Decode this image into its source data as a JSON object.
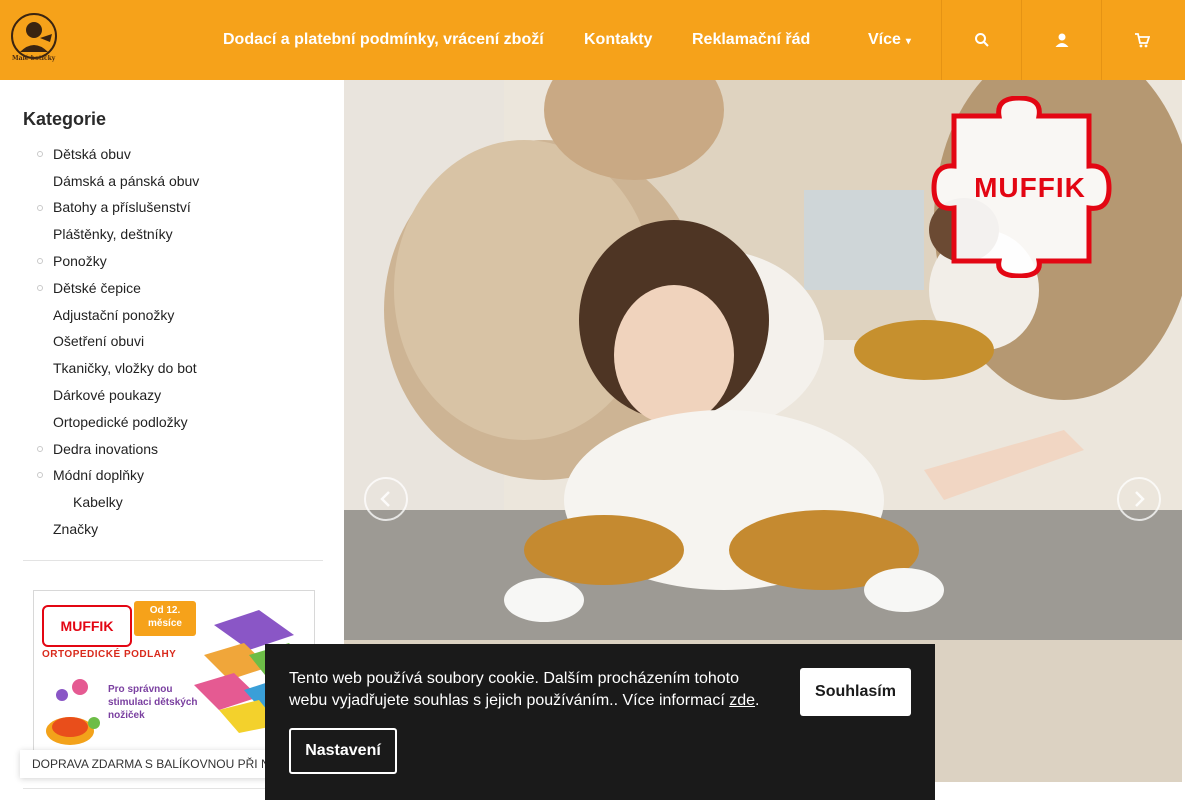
{
  "header": {
    "logo_caption": "Malé botičky",
    "nav": [
      {
        "label": "Dodací a platební podmínky, vrácení zboží"
      },
      {
        "label": "Kontakty"
      },
      {
        "label": "Reklamační řád"
      },
      {
        "label": "Více"
      }
    ],
    "icons": [
      "search-icon",
      "user-icon",
      "cart-icon"
    ],
    "colors": {
      "background": "#f6a21a",
      "text": "#ffffff"
    }
  },
  "sidebar": {
    "title": "Kategorie",
    "items": [
      {
        "label": "Dětská obuv"
      },
      {
        "label": "Dámská a pánská obuv"
      },
      {
        "label": "Batohy a příslušenství"
      },
      {
        "label": "Pláštěnky, deštníky"
      },
      {
        "label": "Ponožky"
      },
      {
        "label": "Dětské čepice"
      },
      {
        "label": "Adjustační ponožky"
      },
      {
        "label": "Ošetření obuvi"
      },
      {
        "label": "Tkaničky, vložky do bot"
      },
      {
        "label": "Dárkové poukazy"
      },
      {
        "label": "Ortopedické podložky"
      },
      {
        "label": "Dedra inovations"
      },
      {
        "label": "Módní doplňky"
      },
      {
        "label": "Kabelky"
      },
      {
        "label": "Značky"
      }
    ],
    "banner": {
      "brand": "MUFFIK",
      "age": "Od 12. měsíce",
      "headline": "ORTOPEDICKÉ PODLAHY",
      "subline": "Pro správnou stimulaci dětských nožiček"
    },
    "shipping_notice": "DOPRAVA ZDARMA S BALÍKOVNOU PŘI N"
  },
  "hero": {
    "brand": "MUFFIK",
    "prev_icon": "chevron-left-icon",
    "next_icon": "chevron-right-icon"
  },
  "cookie": {
    "text": "Tento web používá soubory cookie. Dalším procházením tohoto webu vyjadřujete souhlas s jejich používáním.. Více informací",
    "link": "zde",
    "after_link": ".",
    "accept_label": "Souhlasím",
    "settings_label": "Nastavení"
  }
}
